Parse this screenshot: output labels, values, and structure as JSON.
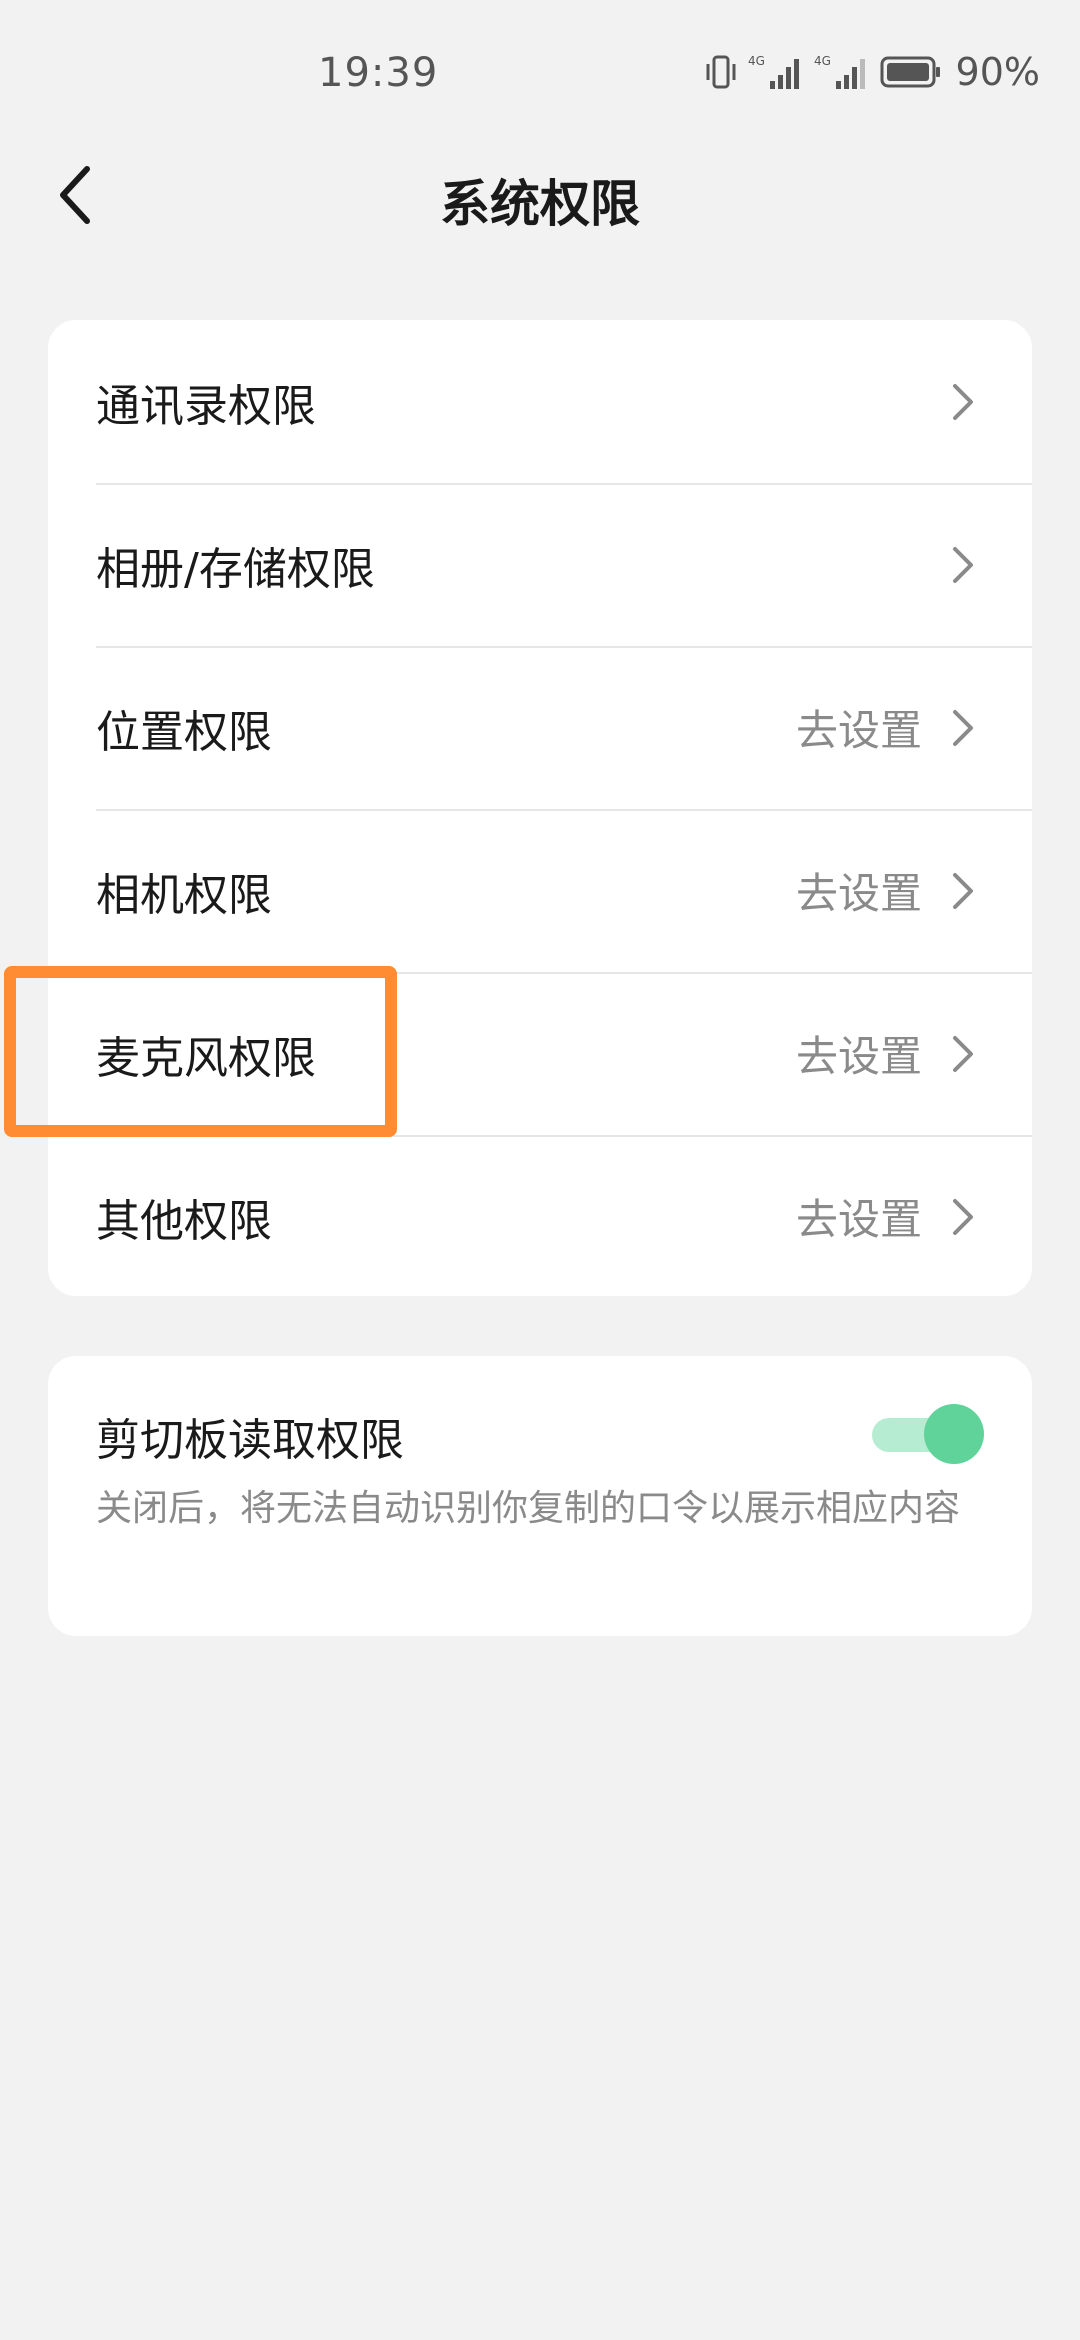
{
  "status_bar": {
    "time": "19:39",
    "battery_percent": "90%",
    "icons": [
      "vibrate-icon",
      "signal-4g-icon",
      "signal-4g-icon",
      "battery-icon"
    ]
  },
  "header": {
    "back_icon": "chevron-left-icon",
    "title": "系统权限"
  },
  "permissions": [
    {
      "label": "通讯录权限",
      "action": ""
    },
    {
      "label": "相册/存储权限",
      "action": ""
    },
    {
      "label": "位置权限",
      "action": "去设置"
    },
    {
      "label": "相机权限",
      "action": "去设置"
    },
    {
      "label": "麦克风权限",
      "action": "去设置"
    },
    {
      "label": "其他权限",
      "action": "去设置"
    }
  ],
  "clipboard": {
    "title": "剪切板读取权限",
    "description": "关闭后，将无法自动识别你复制的口令以展示相应内容",
    "enabled": true
  },
  "colors": {
    "background": "#f2f2f2",
    "card": "#ffffff",
    "toggle_on": "#5fd39a",
    "highlight": "#ff8c33"
  }
}
